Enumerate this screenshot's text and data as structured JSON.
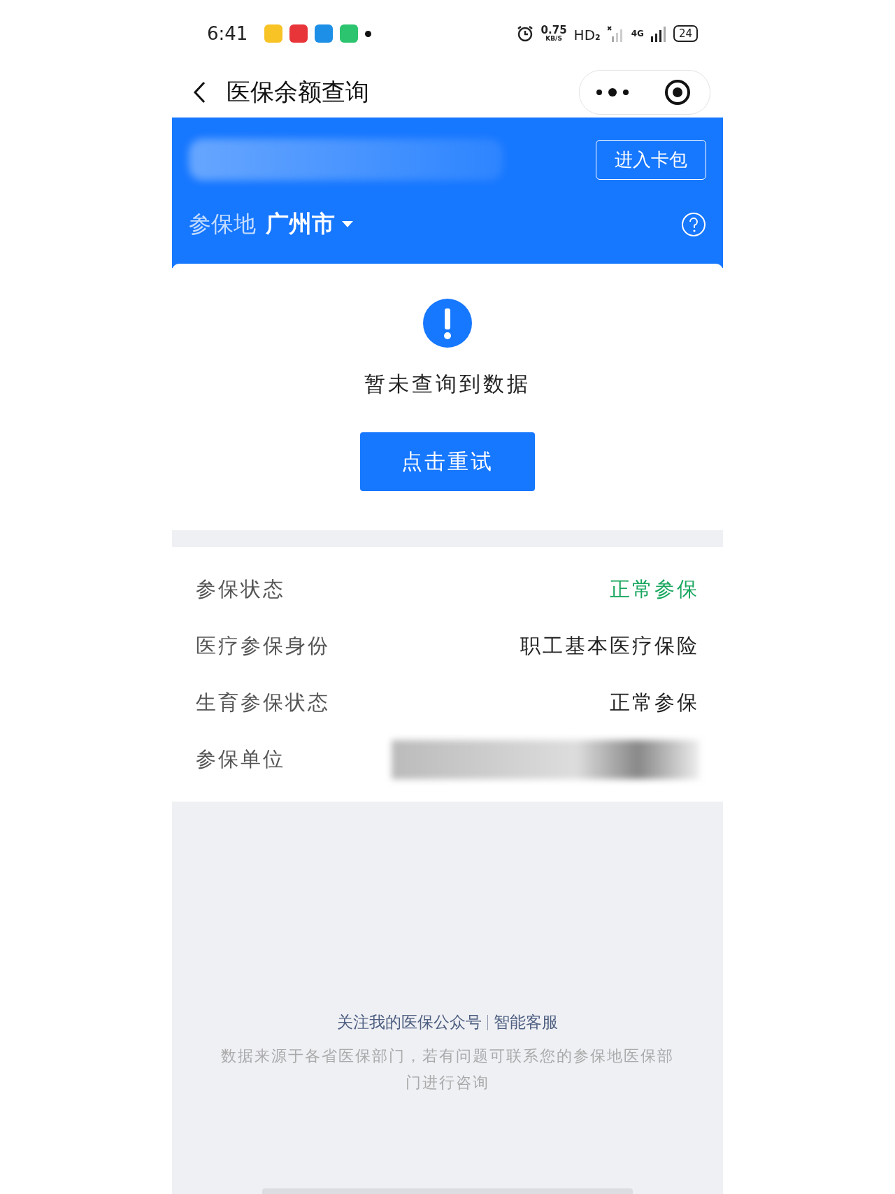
{
  "status_bar": {
    "time": "6:41",
    "app_icons": [
      {
        "color": "#f7c325"
      },
      {
        "color": "#e8353a"
      },
      {
        "color": "#1e8fe6"
      },
      {
        "color": "#2cc46e"
      }
    ],
    "speed": "0.75",
    "speed_unit": "KB/S",
    "hd": "HD",
    "hd_index": "2",
    "network": "4G",
    "battery": "24"
  },
  "nav": {
    "title": "医保余额查询"
  },
  "header": {
    "card_button": "进入卡包",
    "location_label": "参保地",
    "location": "广州市"
  },
  "empty_state": {
    "message": "暂未查询到数据",
    "retry_button": "点击重试"
  },
  "info_rows": [
    {
      "label": "参保状态",
      "value": "正常参保",
      "highlight": true
    },
    {
      "label": "医疗参保身份",
      "value": "职工基本医疗保险",
      "highlight": false
    },
    {
      "label": "生育参保状态",
      "value": "正常参保",
      "highlight": false
    },
    {
      "label": "参保单位",
      "kind": "redacted"
    }
  ],
  "footer": {
    "links": [
      "关注我的医保公众号",
      "智能客服"
    ],
    "note": "数据来源于各省医保部门，若有问题可联系您的参保地医保部门进行咨询"
  }
}
